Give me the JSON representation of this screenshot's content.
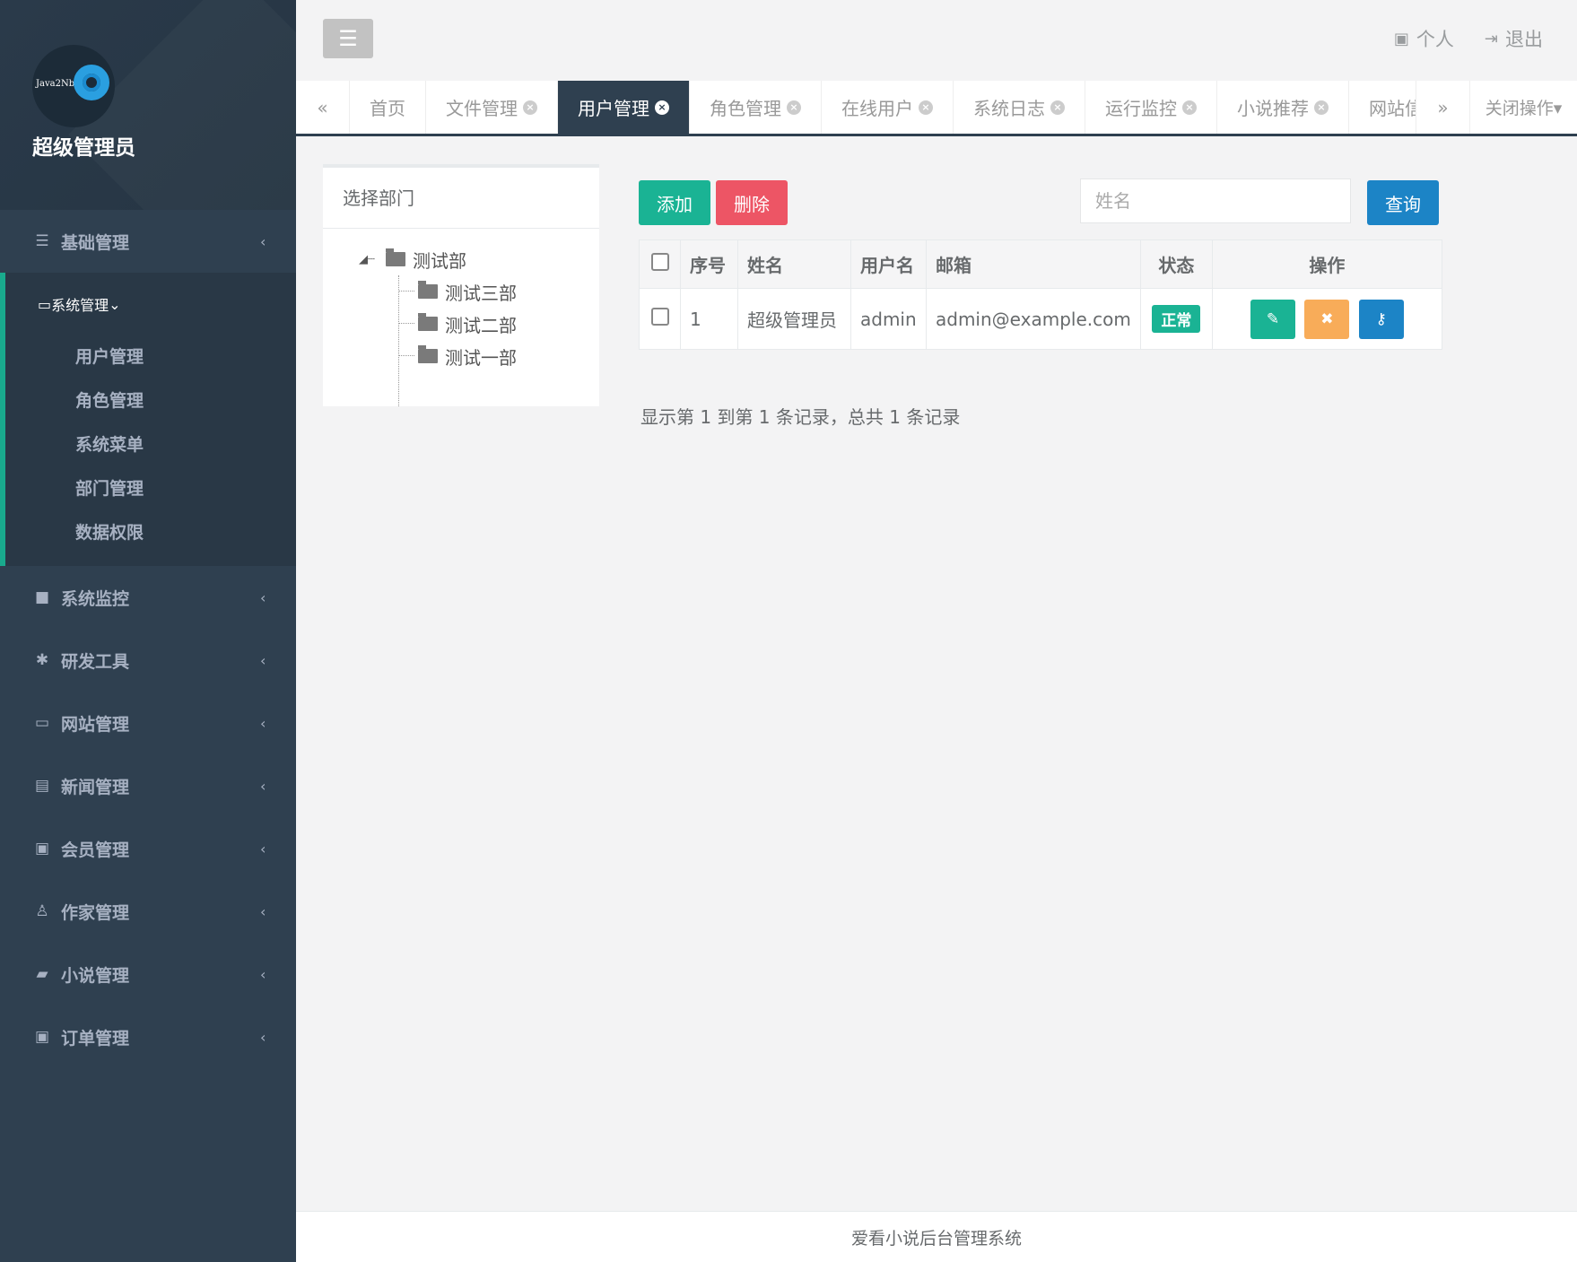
{
  "sidebar": {
    "logo_text": "Java2Nb",
    "role_name": "超级管理员",
    "menu": [
      {
        "icon": "☰",
        "label": "基础管理",
        "arrow": "‹"
      },
      {
        "icon": "▭",
        "label": "系统管理",
        "arrow": "⌄",
        "children": [
          "用户管理",
          "角色管理",
          "系统菜单",
          "部门管理",
          "数据权限"
        ]
      },
      {
        "icon": "■",
        "label": "系统监控",
        "arrow": "‹"
      },
      {
        "icon": "✱",
        "label": "研发工具",
        "arrow": "‹"
      },
      {
        "icon": "▭",
        "label": "网站管理",
        "arrow": "‹"
      },
      {
        "icon": "▤",
        "label": "新闻管理",
        "arrow": "‹"
      },
      {
        "icon": "▣",
        "label": "会员管理",
        "arrow": "‹"
      },
      {
        "icon": "♙",
        "label": "作家管理",
        "arrow": "‹"
      },
      {
        "icon": "▰",
        "label": "小说管理",
        "arrow": "‹"
      },
      {
        "icon": "▣",
        "label": "订单管理",
        "arrow": "‹"
      }
    ]
  },
  "topbar": {
    "toggle_icon": "☰",
    "personal_label": "个人",
    "logout_label": "退出"
  },
  "tabs": {
    "prev_icon": "«",
    "next_icon": "»",
    "items": [
      {
        "label": "首页",
        "closable": false,
        "active": false
      },
      {
        "label": "文件管理",
        "closable": true,
        "active": false
      },
      {
        "label": "用户管理",
        "closable": true,
        "active": true
      },
      {
        "label": "角色管理",
        "closable": true,
        "active": false
      },
      {
        "label": "在线用户",
        "closable": true,
        "active": false
      },
      {
        "label": "系统日志",
        "closable": true,
        "active": false
      },
      {
        "label": "运行监控",
        "closable": true,
        "active": false
      },
      {
        "label": "小说推荐",
        "closable": true,
        "active": false
      },
      {
        "label": "网站信",
        "closable": false,
        "active": false
      }
    ],
    "close_ops_label": "关闭操作▾"
  },
  "dept": {
    "title": "选择部门",
    "root": "测试部",
    "children": [
      "测试三部",
      "测试二部",
      "测试一部"
    ]
  },
  "toolbar": {
    "add_label": "添加",
    "delete_label": "删除",
    "search_placeholder": "姓名",
    "query_label": "查询"
  },
  "table": {
    "headers": [
      "序号",
      "姓名",
      "用户名",
      "邮箱",
      "状态",
      "操作"
    ],
    "rows": [
      {
        "index": "1",
        "name": "超级管理员",
        "username": "admin",
        "email": "admin@example.com",
        "status": "正常"
      }
    ]
  },
  "pager": {
    "info": "显示第 1 到第 1 条记录，总共 1 条记录"
  },
  "footer": {
    "text": "爱看小说后台管理系统"
  },
  "colors": {
    "sidebar_bg": "#2f4050",
    "accent_green": "#1ab394",
    "danger_red": "#ed5565",
    "primary_blue": "#1c84c6",
    "warning_orange": "#f8ac59"
  }
}
